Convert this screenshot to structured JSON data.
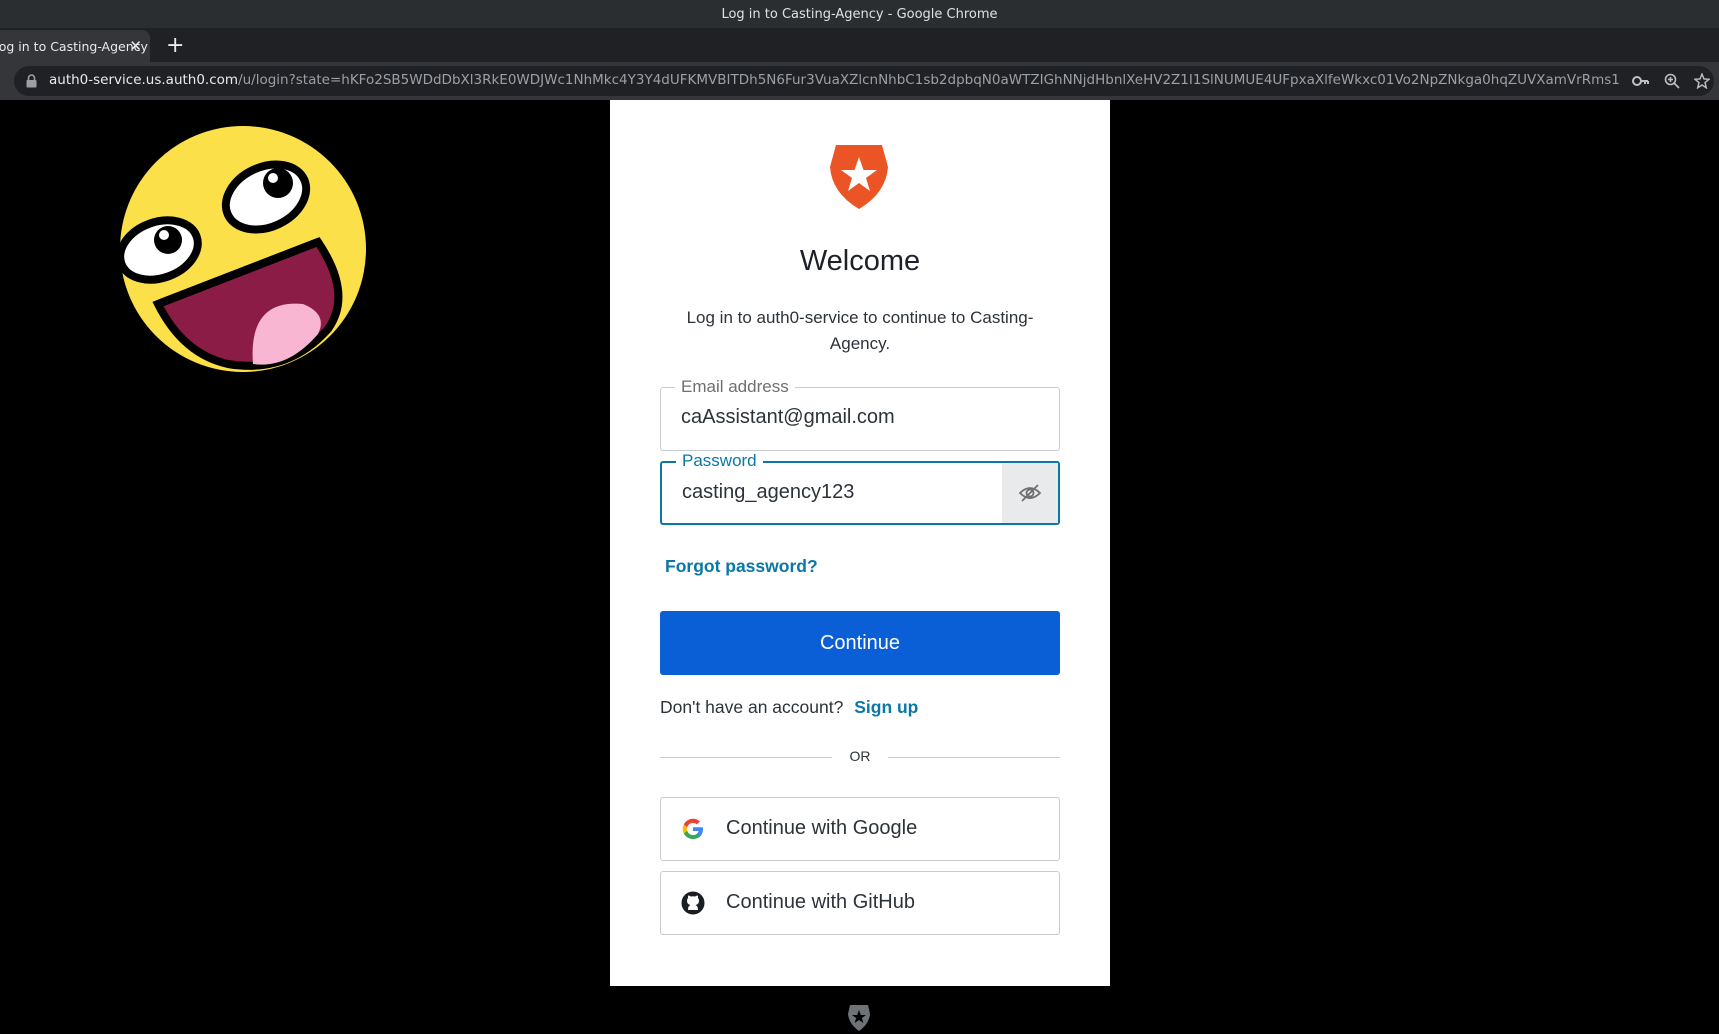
{
  "window": {
    "title": "Log in to Casting-Agency - Google Chrome"
  },
  "tab": {
    "label": "Log in to Casting-Agency",
    "close": "✕",
    "new_tab": "+"
  },
  "address_bar": {
    "host": "auth0-service.us.auth0.com",
    "path": "/u/login?state=hKFo2SB5WDdDbXl3RkE0WDJWc1NhMkc4Y3Y4dUFKMVBITDh5N6Fur3VuaXZlcnNhbC1sb2dpbqN0aWTZIGhNNjdHbnlXeHV2Z1I1SlNUMUE4UFpxaXlfeWkxc01Vo2NpZNkga0hqZUVXamVrRms1a..."
  },
  "login": {
    "heading": "Welcome",
    "subtitle": "Log in to auth0-service to continue to Casting-Agency.",
    "email": {
      "label": "Email address",
      "value": "caAssistant@gmail.com"
    },
    "password": {
      "label": "Password",
      "value": "casting_agency123"
    },
    "forgot_password": "Forgot password?",
    "continue_label": "Continue",
    "no_account_text": "Don't have an account?",
    "signup_label": "Sign up",
    "or_text": "OR",
    "google_label": "Continue with Google",
    "github_label": "Continue with GitHub"
  },
  "colors": {
    "primary": "#0b5fd6",
    "link": "#0a78a6",
    "brand_logo": "#eb5424"
  },
  "icons": [
    "lock-icon",
    "key-icon",
    "zoom-icon",
    "star-icon",
    "auth0-logo-icon",
    "eye-slash-icon",
    "google-icon",
    "github-icon"
  ]
}
